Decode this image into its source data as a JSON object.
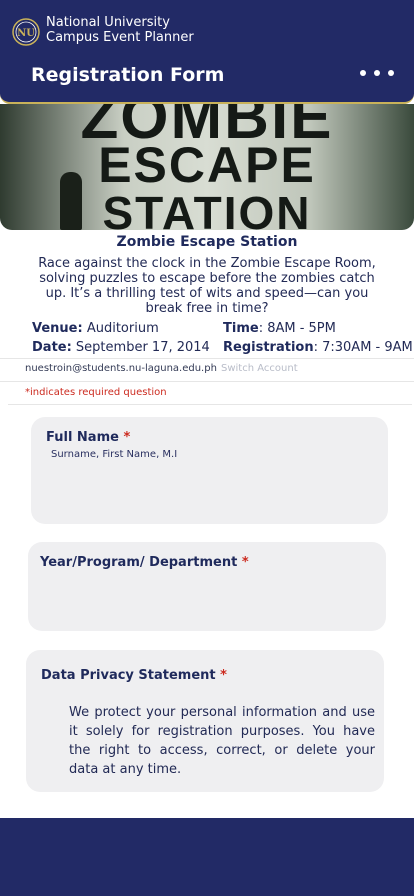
{
  "header": {
    "org_line1": "National University",
    "org_line2": "Campus Event Planner",
    "form_title": "Registration Form",
    "menu_icon": "more-horizontal-icon",
    "logo_icon": "nu-seal-logo",
    "colors": {
      "primary": "#222a66",
      "accent": "#c9b25a"
    }
  },
  "banner": {
    "line1": "ZOMBIE",
    "line2": "ESCAPE",
    "line3": "STATION"
  },
  "event": {
    "title": "Zombie Escape Station",
    "description": "Race against the clock in the Zombie Escape Room, solving puzzles to escape before the zombies catch up. It’s a thrilling test of wits and speed—can you break free in time?",
    "venue_label": "Venue:",
    "venue_value": " Auditorium",
    "time_label": "Time",
    "time_value": ": 8AM - 5PM",
    "date_label": "Date:",
    "date_value": " September 17, 2014",
    "registration_label": "Registration",
    "registration_value": ": 7:30AM - 9AM"
  },
  "account": {
    "email": "nuestroin@students.nu-laguna.edu.ph",
    "switch_label": "Switch Account"
  },
  "required_note": "*indicates required question",
  "questions": {
    "full_name": {
      "label": "Full Name",
      "required_mark": "*",
      "placeholder": "Surname, First Name, M.I"
    },
    "year_program": {
      "label": "Year/Program/ Department",
      "required_mark": "*"
    },
    "privacy": {
      "label": "Data Privacy Statement",
      "required_mark": "*",
      "text": "We protect your personal information and use it solely for registration purposes. You have the right to access, correct, or delete your data at any time."
    }
  },
  "colors": {
    "required": "#cc2a1f",
    "card_bg": "#efeff1"
  }
}
